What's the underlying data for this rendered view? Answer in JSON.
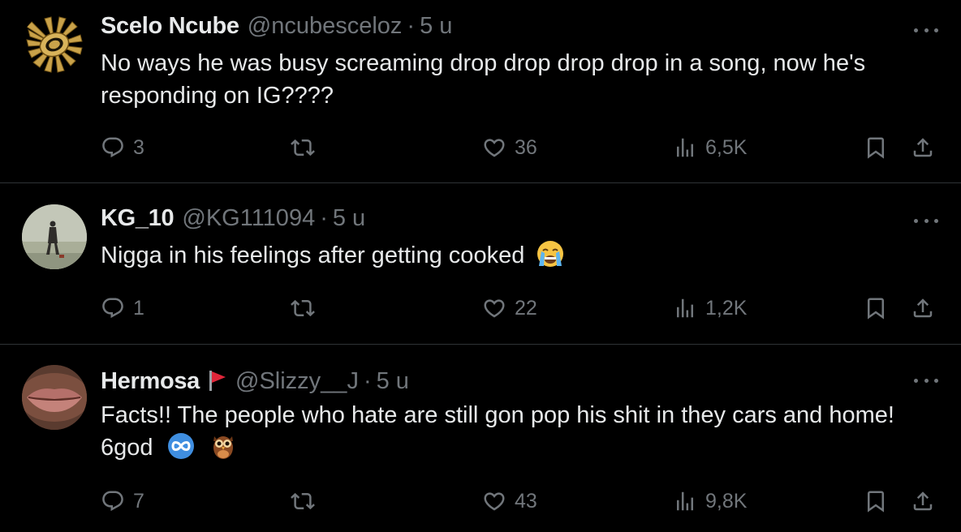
{
  "tweets": [
    {
      "name": "Scelo Ncube",
      "handle": "@ncubesceloz",
      "sep": "·",
      "time": "5 u",
      "text_lines": [
        "No ways he was busy screaming drop drop drop drop in a song, now he's",
        "responding on IG????"
      ],
      "replies": "3",
      "likes": "36",
      "views": "6,5K",
      "avatar": "kaizer-chiefs-logo"
    },
    {
      "name": "KG_10",
      "handle": "@KG111094",
      "sep": "·",
      "time": "5 u",
      "text_lines": [
        "Nigga in his feelings after getting cooked"
      ],
      "emoji": "loudly-crying-face",
      "replies": "1",
      "likes": "22",
      "views": "1,2K",
      "avatar": "person-in-snow-photo"
    },
    {
      "name": "Hermosa",
      "name_icon": "red-flag",
      "handle": "@Slizzy__J",
      "sep": "·",
      "time": "5 u",
      "text_lines": [
        "Facts!! The people who hate are still gon pop his shit in they cars and home!",
        "6god"
      ],
      "emojis": [
        "infinity",
        "owl"
      ],
      "replies": "7",
      "likes": "43",
      "views": "9,8K",
      "avatar": "lips-closeup-photo"
    }
  ],
  "colors": {
    "background": "#000000",
    "text": "#e7e9ea",
    "muted": "#71767b",
    "divider": "#2f3336"
  }
}
